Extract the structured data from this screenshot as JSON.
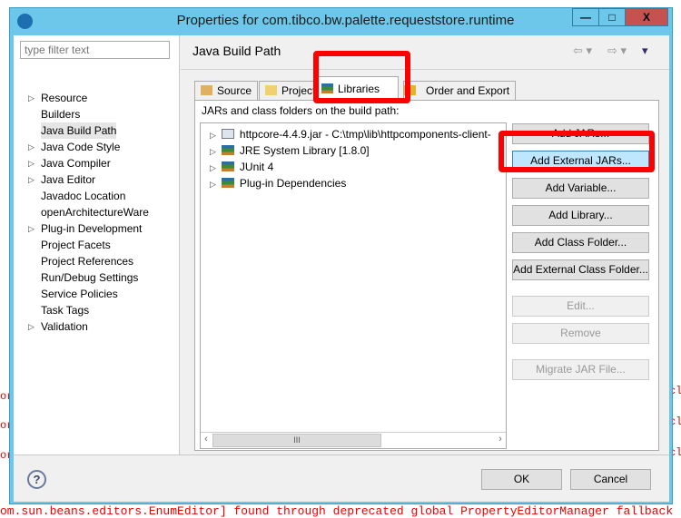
{
  "background": {
    "console_line": "om.sun.beans.editors.EnumEditor] found through deprecated global PropertyEditorManager fallback",
    "right_fragment": "cl",
    "left_fragment": "or"
  },
  "window": {
    "title": "Properties for com.tibco.bw.palette.requeststore.runtime",
    "minimize": "—",
    "maximize": "□",
    "close": "X"
  },
  "sidebar": {
    "filter_placeholder": "type filter text",
    "items": [
      {
        "label": "Resource",
        "expandable": true
      },
      {
        "label": "Builders",
        "expandable": false
      },
      {
        "label": "Java Build Path",
        "expandable": false,
        "selected": true
      },
      {
        "label": "Java Code Style",
        "expandable": true
      },
      {
        "label": "Java Compiler",
        "expandable": true
      },
      {
        "label": "Java Editor",
        "expandable": true
      },
      {
        "label": "Javadoc Location",
        "expandable": false
      },
      {
        "label": "openArchitectureWare",
        "expandable": false
      },
      {
        "label": "Plug-in Development",
        "expandable": true
      },
      {
        "label": "Project Facets",
        "expandable": false
      },
      {
        "label": "Project References",
        "expandable": false
      },
      {
        "label": "Run/Debug Settings",
        "expandable": false
      },
      {
        "label": "Service Policies",
        "expandable": false
      },
      {
        "label": "Task Tags",
        "expandable": false
      },
      {
        "label": "Validation",
        "expandable": true
      }
    ]
  },
  "main": {
    "title": "Java Build Path",
    "tabs": [
      {
        "label": "Source",
        "icon": "source-folder-icon"
      },
      {
        "label": "Projects",
        "icon": "folder-icon"
      },
      {
        "label": "Libraries",
        "icon": "library-icon",
        "active": true
      },
      {
        "label": "Order and Export",
        "icon": "order-icon"
      }
    ],
    "list_label": "JARs and class folders on the build path:",
    "entries": [
      {
        "label": "httpcore-4.4.9.jar - C:\\tmp\\lib\\httpcomponents-client-",
        "icon": "jar-icon"
      },
      {
        "label": "JRE System Library [1.8.0]",
        "icon": "library-icon"
      },
      {
        "label": "JUnit 4",
        "icon": "library-icon"
      },
      {
        "label": "Plug-in Dependencies",
        "icon": "library-icon"
      }
    ],
    "buttons": [
      {
        "label": "Add JARs...",
        "enabled": true
      },
      {
        "label": "Add External JARs...",
        "enabled": true,
        "highlighted": true
      },
      {
        "label": "Add Variable...",
        "enabled": true
      },
      {
        "label": "Add Library...",
        "enabled": true
      },
      {
        "label": "Add Class Folder...",
        "enabled": true
      },
      {
        "label": "Add External Class Folder...",
        "enabled": true
      },
      {
        "label": "Edit...",
        "enabled": false
      },
      {
        "label": "Remove",
        "enabled": false
      },
      {
        "label": "Migrate JAR File...",
        "enabled": false
      }
    ]
  },
  "footer": {
    "help": "?",
    "ok": "OK",
    "cancel": "Cancel"
  },
  "colors": {
    "titlebar": "#6cc7ea",
    "close": "#c75050",
    "highlight": "#ff0000",
    "console_text": "#ee0000"
  }
}
